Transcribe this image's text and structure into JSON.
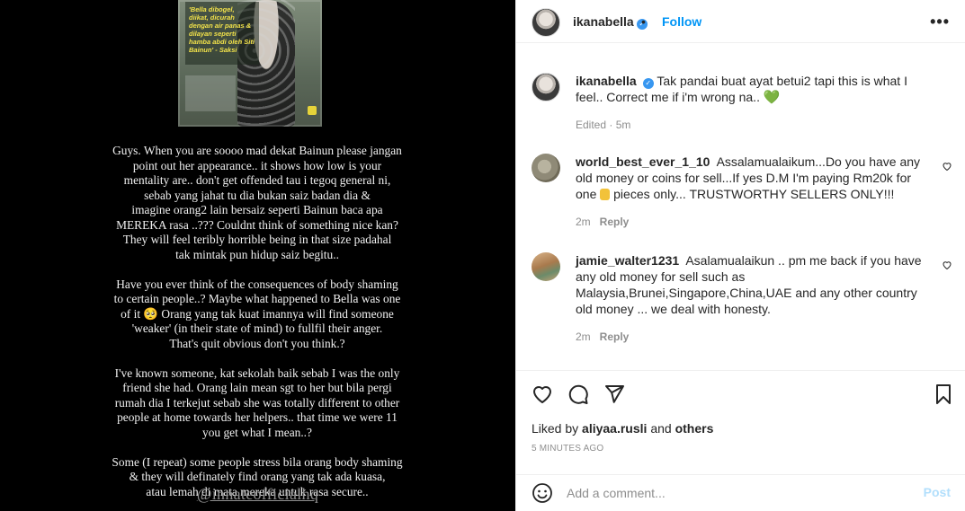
{
  "story": {
    "image_caption": "'Bella dibogel, diikat, dicurah dengan air panas & dilayan seperti hamba abdi oleh Siti Bainun' - Saksi",
    "paragraphs": [
      "Guys. When you are soooo mad dekat Bainun please jangan\npoint out her appearance.. it shows how low is your\nmentality are.. don't get offended tau i tegoq general ni,\nsebab yang jahat tu dia bukan saiz badan dia &\nimagine orang2 lain bersaiz seperti Bainun baca apa\nMEREKA rasa ..??? Couldnt think of something nice kan?\nThey will feel teribly horrible being in that size padahal\ntak mintak pun hidup saiz begitu..",
      "Have you ever think of the consequences of body shaming\nto certain people..? Maybe what happened to Bella was one\nof it 🥺 Orang yang tak kuat imannya will find someone\n'weaker' (in their state of mind) to fullfil their anger.\nThat's quit obvious don't you think.?",
      "I've known someone, kat sekolah baik sebab I was the only\nfriend she had. Orang lain mean sgt to her but bila pergi\nrumah dia I terkejut sebab she was totally different to other\npeople at home towards her helpers.. that time we were 11\nyou get what I mean..?",
      "Some (I repeat) some people stress bila orang body shaming\n& they will definately find orang yang tak ada kuasa,\natau lemah di mata mereka untuk rasa secure.."
    ],
    "tag": "@innateofficialhq"
  },
  "header": {
    "username": "ikanabella",
    "dot": "•",
    "follow_label": "Follow",
    "more_label": "•••"
  },
  "caption": {
    "username": "ikanabella",
    "text": "Tak pandai buat ayat betui2 tapi this is what I feel.. Correct me if i'm wrong na..",
    "emoji": "💚",
    "meta": "Edited · 5m"
  },
  "comments": [
    {
      "username": "world_best_ever_1_10",
      "text": "Assalamualaikum...Do you have any old money or coins for sell...If yes D.M I'm paying Rm20k for one",
      "text_after": "pieces only... TRUSTWORTHY SELLERS ONLY!!!",
      "time": "2m",
      "reply_label": "Reply"
    },
    {
      "username": "jamie_walter1231",
      "text": "Asalamualaikun .. pm me back if you have any old money for sell such as Malaysia,Brunei,Singapore,China,UAE and any other country old money ... we deal with honesty.",
      "time": "2m",
      "reply_label": "Reply"
    }
  ],
  "likes": {
    "prefix": "Liked by",
    "user": "aliyaa.rusli",
    "joiner": "and",
    "others": "others"
  },
  "time_ago": "5 minutes ago",
  "add_comment": {
    "placeholder": "Add a comment...",
    "post_label": "Post"
  }
}
